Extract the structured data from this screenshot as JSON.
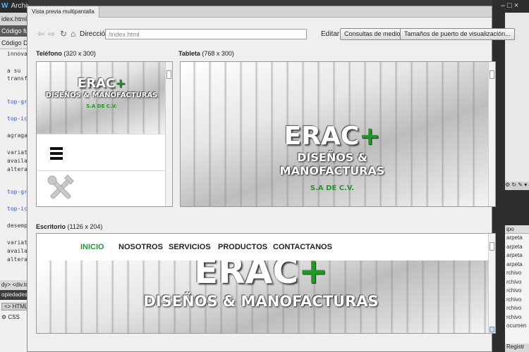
{
  "background_editor": {
    "app_logo": "W",
    "menu_item": "Archivo",
    "file_tab": "idex.html",
    "close_glyph": "X",
    "source_tab": "Código fuente",
    "view_tabs": [
      "Código",
      "Di"
    ],
    "code_lines": [
      {
        "text": "innova",
        "blue": false
      },
      {
        "text": "a su",
        "blue": false
      },
      {
        "text": "transf",
        "blue": false
      },
      {
        "text": "top-gr",
        "blue": true
      },
      {
        "text": "top-ic",
        "blue": true
      },
      {
        "text": "agraga",
        "blue": false
      },
      {
        "text": "variat",
        "blue": false
      },
      {
        "text": "availa",
        "blue": false
      },
      {
        "text": "altera",
        "blue": false
      },
      {
        "text": "top-gr",
        "blue": true
      },
      {
        "text": "top-ic",
        "blue": true
      },
      {
        "text": "desemp",
        "blue": false
      },
      {
        "text": "variat",
        "blue": false
      },
      {
        "text": "availa",
        "blue": false
      },
      {
        "text": "altera",
        "blue": false
      }
    ],
    "status_path": "dy> <div.top",
    "properties_label": "opiedades",
    "html_button": "HTML",
    "css_button": "CSS"
  },
  "right_panels": {
    "window_controls": [
      "–",
      "□",
      "×"
    ],
    "list_header": "ipo",
    "list_items": [
      "arpeta",
      "arpeta",
      "arpeta",
      "arpeta",
      "rchivo",
      "rchivo",
      "rchivo",
      "rchivo",
      "rchivo",
      "rchivo",
      "ocumen"
    ],
    "register_button": "Registr"
  },
  "dialog": {
    "tab_title": "Vista previa multipantalla",
    "address_label": "Dirección:",
    "address_value": "/index.html",
    "edit_label": "Editar:",
    "media_query_button": "Consultas de medios...",
    "viewport_button": "Tamaños de puerto de visualización...",
    "icons": {
      "back": "arrow-left-icon",
      "forward": "arrow-right-icon",
      "refresh": "refresh-icon",
      "home": "home-icon"
    }
  },
  "panes": {
    "phone": {
      "label": "Teléfono",
      "size": "(320 x 300)"
    },
    "tablet": {
      "label": "Tableta",
      "size": "(768 x 300)"
    },
    "desktop": {
      "label": "Escritorio",
      "size": "(1126 x 204)"
    }
  },
  "site": {
    "brand_name": "ERAC",
    "brand_plus": "+",
    "tagline": "DISEÑOS & MANOFACTURAS",
    "suffix": "S.A DE C.V.",
    "nav": [
      {
        "label": "INICIO",
        "active": true
      },
      {
        "label": "NOSOTROS",
        "active": false
      },
      {
        "label": "SERVICIOS",
        "active": false
      },
      {
        "label": "PRODUCTOS",
        "active": false
      },
      {
        "label": "CONTACTANOS",
        "active": false
      }
    ],
    "accent_color": "#1d9a23"
  }
}
